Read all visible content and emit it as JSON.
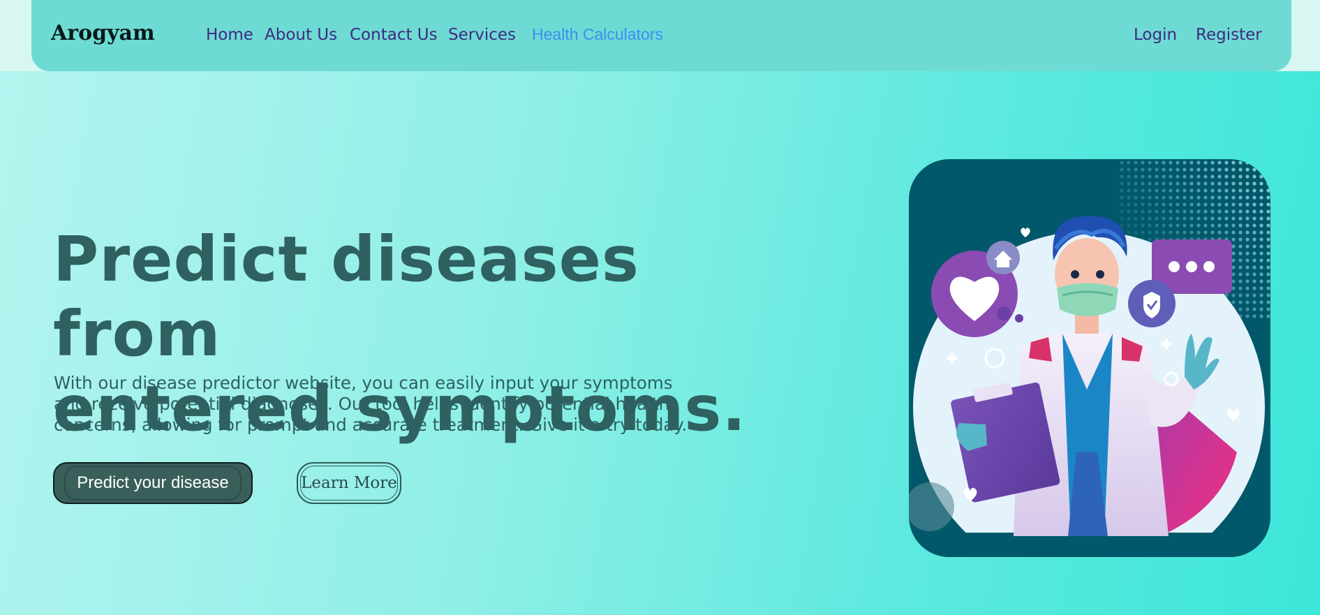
{
  "navbar": {
    "brand": "Arogyam",
    "links": [
      "Home",
      "About Us",
      "Contact Us",
      "Services",
      "Health Calculators"
    ],
    "auth": {
      "login": "Login",
      "register": "Register"
    }
  },
  "hero": {
    "title_line1": "Predict diseases from",
    "title_line2": "entered symptoms.",
    "description_line1": "With our disease predictor website, you can easily input your symptoms",
    "description_line2": "and receive potential diagnoses. Our tool helps identify potential health",
    "description_line3": "concerns, allowing for prompt and accurate treatment. Give it a try today.",
    "primary_button": "Predict your disease",
    "secondary_button": "Learn More"
  },
  "colors": {
    "navbar_bg": "#6ddbd4",
    "nav_link": "#402a80",
    "nav_link_active": "#3b8ef0",
    "hero_text": "#2f6160",
    "primary_button_bg": "#3a5f5a",
    "illustration_bg": "#00586a"
  },
  "illustration": {
    "icon": "doctor-illustration-icon"
  }
}
